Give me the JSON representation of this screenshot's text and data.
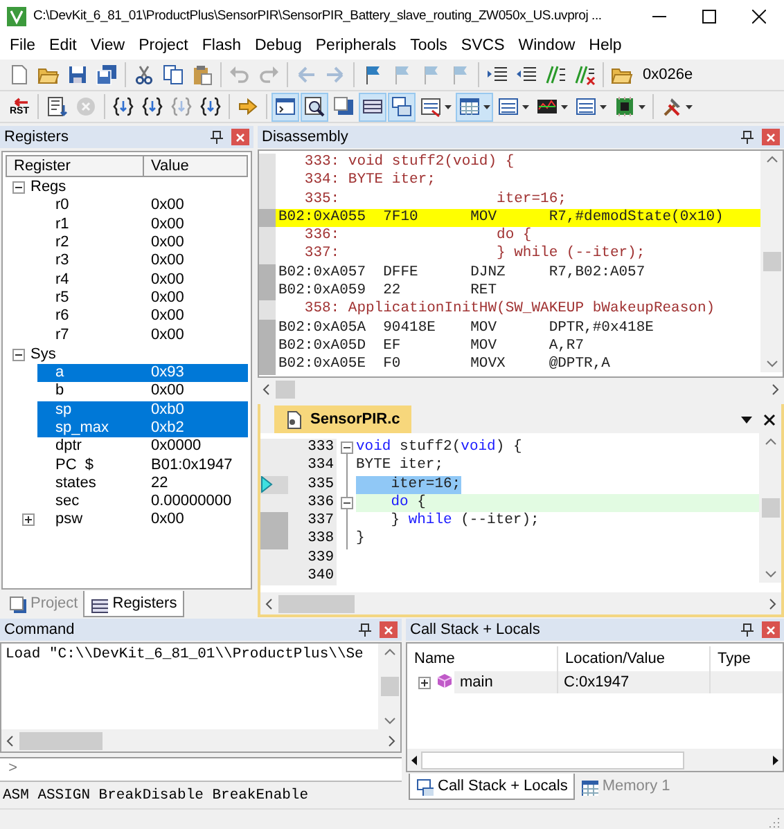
{
  "window": {
    "title": "C:\\DevKit_6_81_01\\ProductPlus\\SensorPIR\\SensorPIR_Battery_slave_routing_ZW050x_US.uvproj ..."
  },
  "menu": [
    "File",
    "Edit",
    "View",
    "Project",
    "Flash",
    "Debug",
    "Peripherals",
    "Tools",
    "SVCS",
    "Window",
    "Help"
  ],
  "toolbar_1": [
    {
      "kind": "button",
      "disabled": false
    },
    {
      "kind": "button",
      "disabled": false
    },
    {
      "kind": "button",
      "disabled": false
    },
    {
      "kind": "button",
      "disabled": false
    },
    {
      "kind": "separator"
    },
    {
      "kind": "button",
      "disabled": false
    },
    {
      "kind": "button",
      "disabled": false
    },
    {
      "kind": "button",
      "disabled": false
    },
    {
      "kind": "separator"
    },
    {
      "kind": "button",
      "disabled": true
    },
    {
      "kind": "button",
      "disabled": true
    },
    {
      "kind": "separator"
    },
    {
      "kind": "button",
      "disabled": true
    },
    {
      "kind": "button",
      "disabled": true
    },
    {
      "kind": "separator"
    },
    {
      "kind": "button",
      "disabled": false
    },
    {
      "kind": "button",
      "disabled": true
    },
    {
      "kind": "button",
      "disabled": true
    },
    {
      "kind": "button",
      "disabled": true
    },
    {
      "kind": "separator"
    },
    {
      "kind": "button",
      "disabled": false
    },
    {
      "kind": "button",
      "disabled": false
    },
    {
      "kind": "button",
      "disabled": false
    },
    {
      "kind": "button",
      "disabled": false
    },
    {
      "kind": "separator"
    },
    {
      "kind": "button",
      "disabled": false
    },
    {
      "kind": "text",
      "text": "0x026e"
    }
  ],
  "toolbar_2": [
    {
      "kind": "button",
      "label": "RST",
      "disabled": false,
      "selected": false,
      "dropdown": false
    },
    {
      "kind": "separator"
    },
    {
      "kind": "button",
      "disabled": false,
      "selected": false,
      "dropdown": false
    },
    {
      "kind": "button",
      "disabled": true,
      "selected": false,
      "dropdown": false
    },
    {
      "kind": "separator"
    },
    {
      "kind": "button",
      "disabled": false,
      "selected": false,
      "dropdown": false
    },
    {
      "kind": "button",
      "disabled": false,
      "selected": false,
      "dropdown": false
    },
    {
      "kind": "button",
      "disabled": true,
      "selected": false,
      "dropdown": false
    },
    {
      "kind": "button",
      "disabled": false,
      "selected": false,
      "dropdown": false
    },
    {
      "kind": "separator"
    },
    {
      "kind": "button",
      "disabled": false,
      "selected": false,
      "dropdown": false
    },
    {
      "kind": "separator"
    },
    {
      "kind": "button",
      "disabled": false,
      "selected": true,
      "dropdown": false
    },
    {
      "kind": "button",
      "disabled": false,
      "selected": true,
      "dropdown": false
    },
    {
      "kind": "button",
      "disabled": false,
      "selected": false,
      "dropdown": false
    },
    {
      "kind": "button",
      "disabled": false,
      "selected": true,
      "dropdown": false
    },
    {
      "kind": "button",
      "disabled": false,
      "selected": true,
      "dropdown": false
    },
    {
      "kind": "button",
      "disabled": false,
      "selected": false,
      "dropdown": true
    },
    {
      "kind": "button",
      "disabled": false,
      "selected": true,
      "dropdown": true
    },
    {
      "kind": "button",
      "disabled": false,
      "selected": false,
      "dropdown": true
    },
    {
      "kind": "button",
      "disabled": false,
      "selected": false,
      "dropdown": true
    },
    {
      "kind": "button",
      "disabled": false,
      "selected": false,
      "dropdown": true
    },
    {
      "kind": "button",
      "disabled": false,
      "selected": false,
      "dropdown": true
    },
    {
      "kind": "separator"
    },
    {
      "kind": "button",
      "disabled": false,
      "selected": false,
      "dropdown": true
    }
  ],
  "registers": {
    "title": "Registers",
    "columns": [
      "Register",
      "Value"
    ],
    "groups": [
      {
        "name": "Regs",
        "expanded": true,
        "children": [
          {
            "name": "r0",
            "value": "0x00",
            "selected": false
          },
          {
            "name": "r1",
            "value": "0x00",
            "selected": false
          },
          {
            "name": "r2",
            "value": "0x00",
            "selected": false
          },
          {
            "name": "r3",
            "value": "0x00",
            "selected": false
          },
          {
            "name": "r4",
            "value": "0x00",
            "selected": false
          },
          {
            "name": "r5",
            "value": "0x00",
            "selected": false
          },
          {
            "name": "r6",
            "value": "0x00",
            "selected": false
          },
          {
            "name": "r7",
            "value": "0x00",
            "selected": false
          }
        ]
      },
      {
        "name": "Sys",
        "expanded": true,
        "children": [
          {
            "name": "a",
            "value": "0x93",
            "selected": true
          },
          {
            "name": "b",
            "value": "0x00",
            "selected": false
          },
          {
            "name": "sp",
            "value": "0xb0",
            "selected": true
          },
          {
            "name": "sp_max",
            "value": "0xb2",
            "selected": true
          },
          {
            "name": "dptr",
            "value": "0x0000",
            "selected": false
          },
          {
            "name": "PC  $",
            "value": "B01:0x1947",
            "selected": false
          },
          {
            "name": "states",
            "value": "22",
            "selected": false
          },
          {
            "name": "sec",
            "value": "0.00000000",
            "selected": false
          },
          {
            "name": "psw",
            "value": "0x00",
            "selected": false,
            "expanded": false
          }
        ]
      }
    ],
    "tabs": [
      {
        "label": "Project",
        "selected": false
      },
      {
        "label": "Registers",
        "selected": true
      }
    ]
  },
  "disassembly": {
    "title": "Disassembly",
    "lines": [
      {
        "kind": "source",
        "text": "   333: void stuff2(void) {",
        "current": false
      },
      {
        "kind": "source",
        "text": "   334: BYTE iter;",
        "current": false
      },
      {
        "kind": "source",
        "text": "   335:                  iter=16;",
        "current": false
      },
      {
        "kind": "asm",
        "text": "B02:0xA055  7F10      MOV      R7,#demodState(0x10)",
        "current": true
      },
      {
        "kind": "source",
        "text": "   336:                  do {",
        "current": false
      },
      {
        "kind": "source",
        "text": "   337:                  } while (--iter);",
        "current": false
      },
      {
        "kind": "asm",
        "text": "B02:0xA057  DFFE      DJNZ     R7,B02:A057",
        "current": false
      },
      {
        "kind": "asm",
        "text": "B02:0xA059  22        RET",
        "current": false
      },
      {
        "kind": "source",
        "text": "   358: ApplicationInitHW(SW_WAKEUP bWakeupReason)",
        "current": false
      },
      {
        "kind": "asm",
        "text": "B02:0xA05A  90418E    MOV      DPTR,#0x418E",
        "current": false
      },
      {
        "kind": "asm",
        "text": "B02:0xA05D  EF        MOV      A,R7",
        "current": false
      },
      {
        "kind": "asm",
        "text": "B02:0xA05E  F0        MOVX     @DPTR,A",
        "current": false
      }
    ]
  },
  "editor": {
    "tabs": [
      {
        "label": "SensorPIR.c",
        "selected": true
      }
    ],
    "lines": [
      {
        "number": "333",
        "fold_start": true,
        "in_fold": false,
        "executed": false,
        "current": false,
        "cursor": false,
        "tokens": [
          {
            "text": "void",
            "kind": "keyword"
          },
          {
            "text": " stuff2(",
            "kind": "plain"
          },
          {
            "text": "void",
            "kind": "keyword"
          },
          {
            "text": ") {",
            "kind": "plain"
          }
        ]
      },
      {
        "number": "334",
        "fold_start": false,
        "in_fold": true,
        "executed": false,
        "current": false,
        "cursor": false,
        "tokens": [
          {
            "text": "BYTE iter;",
            "kind": "plain"
          }
        ]
      },
      {
        "number": "335",
        "fold_start": false,
        "in_fold": true,
        "executed": true,
        "current": true,
        "cursor": false,
        "tokens": [
          {
            "text": "    iter=16;",
            "kind": "plain"
          }
        ]
      },
      {
        "number": "336",
        "fold_start": true,
        "in_fold": true,
        "executed": false,
        "current": false,
        "cursor": true,
        "tokens": [
          {
            "text": "    do",
            "kind": "keyword"
          },
          {
            "text": " {",
            "kind": "plain"
          }
        ]
      },
      {
        "number": "337",
        "fold_start": false,
        "in_fold": true,
        "executed": true,
        "current": false,
        "cursor": false,
        "tokens": [
          {
            "text": "    } ",
            "kind": "plain"
          },
          {
            "text": "while",
            "kind": "keyword"
          },
          {
            "text": " (--iter);",
            "kind": "plain"
          }
        ]
      },
      {
        "number": "338",
        "fold_start": false,
        "in_fold": true,
        "executed": true,
        "current": false,
        "cursor": false,
        "tokens": [
          {
            "text": "}",
            "kind": "plain"
          }
        ]
      },
      {
        "number": "339",
        "fold_start": false,
        "in_fold": false,
        "executed": false,
        "current": false,
        "cursor": false
      },
      {
        "number": "340",
        "fold_start": false,
        "in_fold": false,
        "executed": false,
        "current": false,
        "cursor": false
      }
    ]
  },
  "command": {
    "title": "Command",
    "output": "Load \"C:\\\\DevKit_6_81_01\\\\ProductPlus\\\\Se",
    "prompt": ">",
    "hint": "ASM ASSIGN BreakDisable BreakEnable"
  },
  "call_stack": {
    "title": "Call Stack + Locals",
    "columns": [
      "Name",
      "Location/Value",
      "Type"
    ],
    "rows": [
      {
        "name": "main",
        "location": "C:0x1947",
        "expanded": false
      }
    ],
    "tabs": [
      {
        "label": "Call Stack + Locals",
        "selected": true
      },
      {
        "label": "Memory 1",
        "selected": false
      }
    ]
  }
}
